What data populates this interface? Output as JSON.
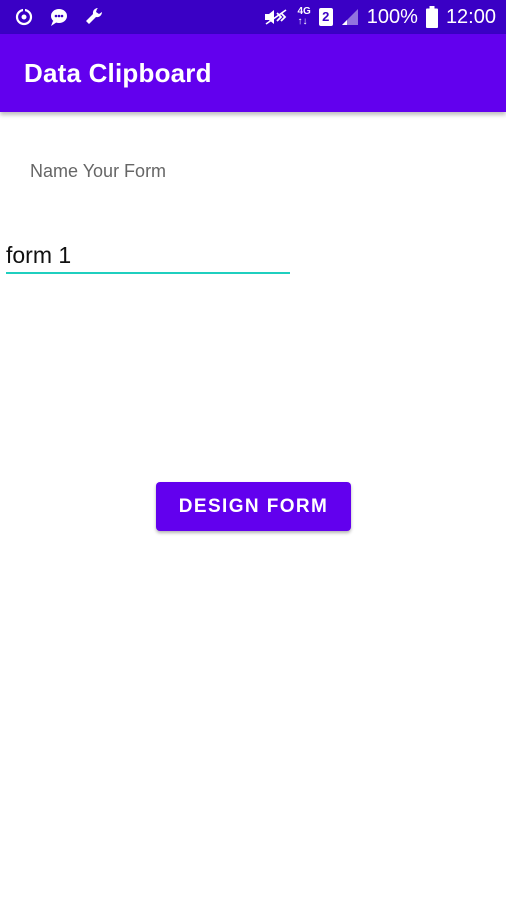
{
  "status_bar": {
    "left_icons": [
      "sync-icon",
      "chat-bubble-icon",
      "wrench-icon"
    ],
    "right_icons": [
      "mute-icon",
      "network-4g-icon",
      "sim-2-icon",
      "signal-icon",
      "battery-icon"
    ],
    "network_top": "4G",
    "network_bottom": "↑↓",
    "sim_number": "2",
    "battery_percent": "100%",
    "time": "12:00"
  },
  "app_bar": {
    "title": "Data Clipboard"
  },
  "form": {
    "label": "Name Your Form",
    "input_value": "form 1",
    "submit_label": "DESIGN FORM"
  },
  "colors": {
    "status_bar": "#3a00c5",
    "primary": "#6200ee",
    "input_underline": "#1fcfbf",
    "background": "#ffffff"
  }
}
